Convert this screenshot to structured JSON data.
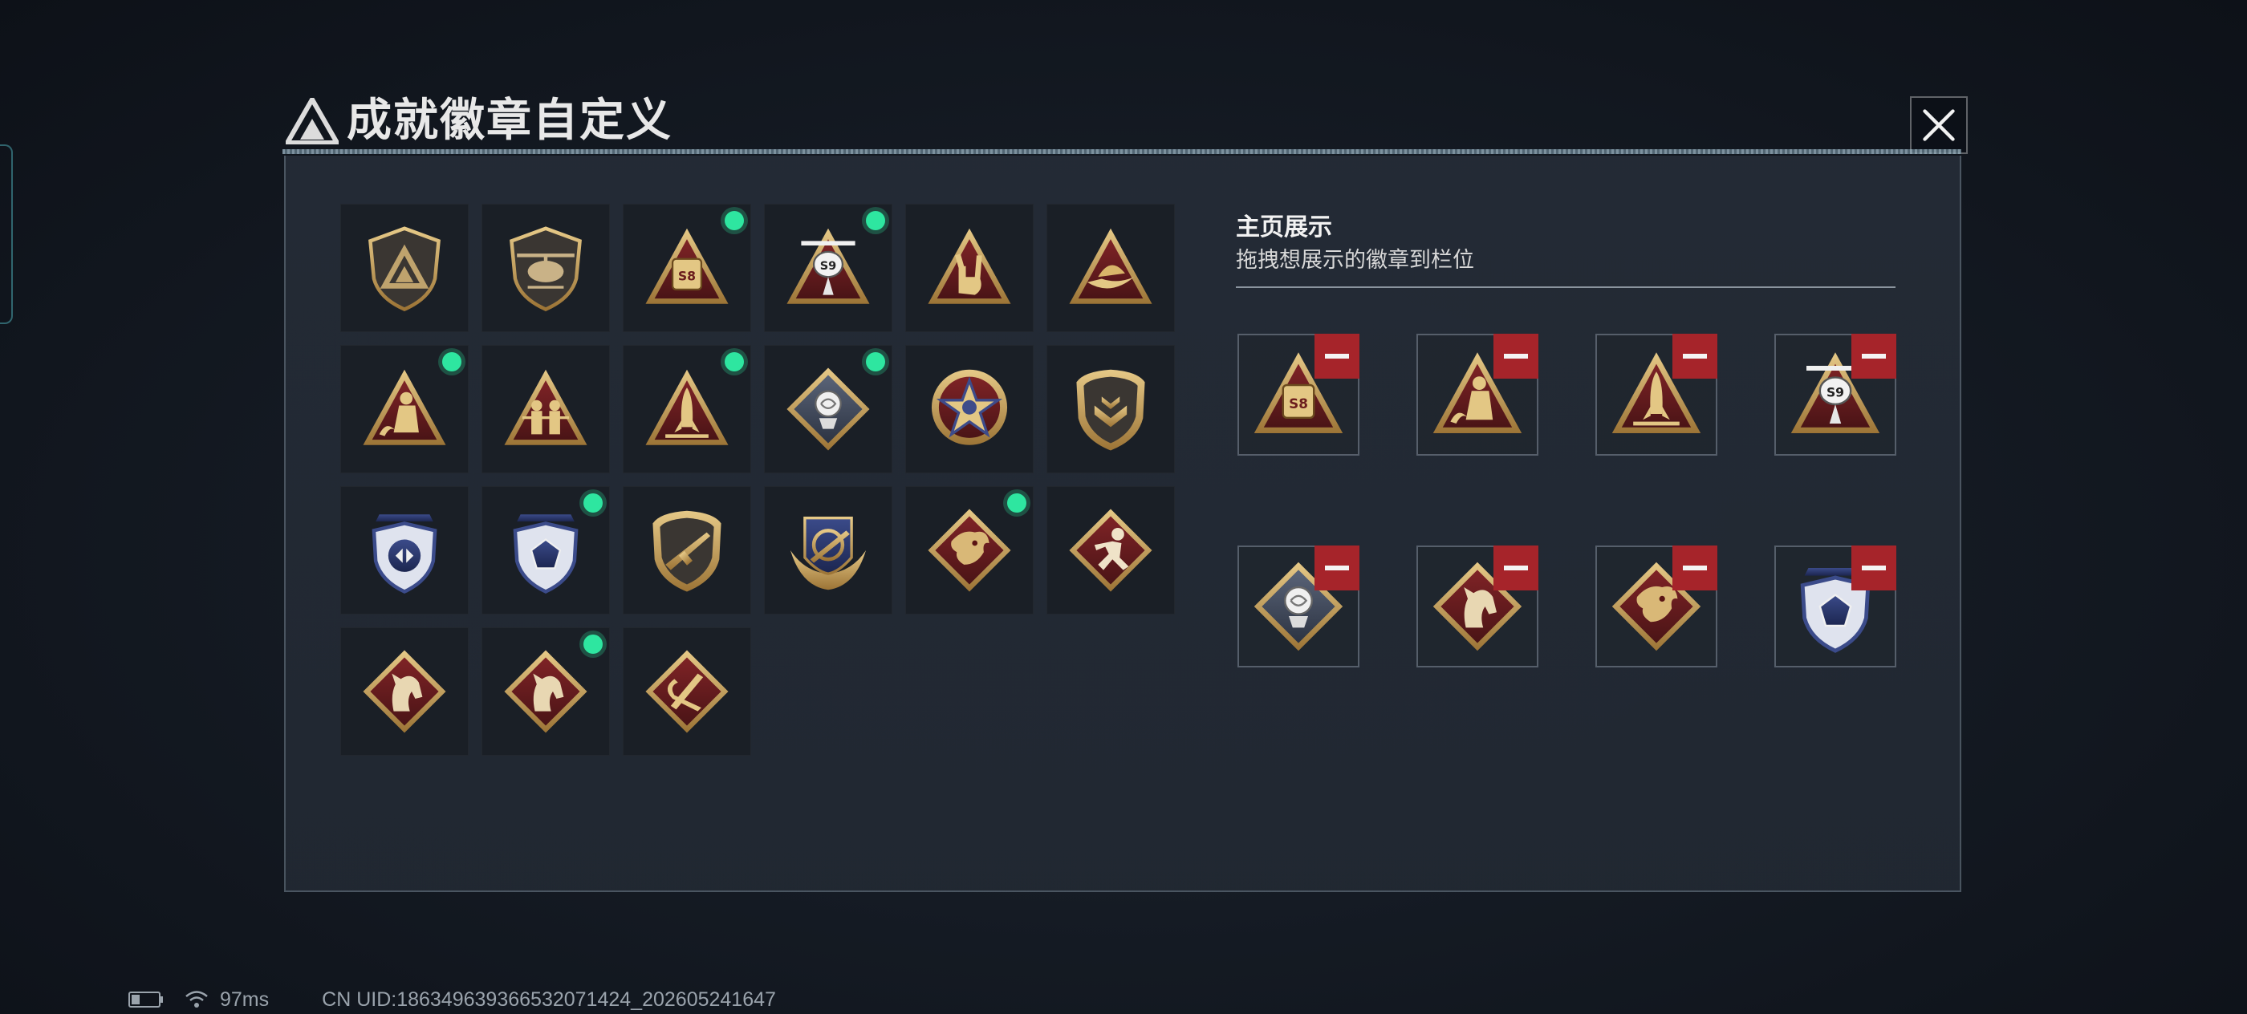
{
  "dialog": {
    "title": "成就徽章自定义"
  },
  "showcase": {
    "title": "主页展示",
    "hint": "拖拽想展示的徽章到栏位",
    "slots": [
      {
        "badge": "fuel-truck-s8-triangle-badge"
      },
      {
        "badge": "wave-figure-triangle-badge"
      },
      {
        "badge": "rocket-triangle-badge"
      },
      {
        "badge": "helicopter-s9-triangle-badge"
      },
      {
        "badge": "rose-diamond-badge"
      },
      {
        "badge": "horse-diamond-badge"
      },
      {
        "badge": "dragon-diamond-badge"
      },
      {
        "badge": "blue-gem-shield-badge"
      }
    ]
  },
  "badges": [
    {
      "icon": "triangle-logo-shield-badge",
      "selected": false
    },
    {
      "icon": "helicopter-shield-badge",
      "selected": false
    },
    {
      "icon": "fuel-truck-s8-triangle-badge",
      "selected": true
    },
    {
      "icon": "helicopter-s9-triangle-badge",
      "selected": true
    },
    {
      "icon": "rock-hand-triangle-badge",
      "selected": false
    },
    {
      "icon": "boat-triangle-badge",
      "selected": false
    },
    {
      "icon": "wave-figure-triangle-badge",
      "selected": true
    },
    {
      "icon": "soldiers-triangle-badge",
      "selected": false
    },
    {
      "icon": "rocket-triangle-badge",
      "selected": true
    },
    {
      "icon": "rose-diamond-badge",
      "selected": true
    },
    {
      "icon": "star-medal-badge",
      "selected": false
    },
    {
      "icon": "chevron-shield-badge",
      "selected": false
    },
    {
      "icon": "blue-arrows-shield-badge",
      "selected": false
    },
    {
      "icon": "blue-gem-shield-badge",
      "selected": true
    },
    {
      "icon": "rifle-shield-badge",
      "selected": false
    },
    {
      "icon": "wings-emblem-badge",
      "selected": false
    },
    {
      "icon": "dragon-diamond-badge",
      "selected": true
    },
    {
      "icon": "runner-diamond-badge",
      "selected": false
    },
    {
      "icon": "horse-diamond-badge",
      "selected": false
    },
    {
      "icon": "horse-diamond-badge",
      "selected": true
    },
    {
      "icon": "tools-diamond-badge",
      "selected": false
    }
  ],
  "status": {
    "latency": "97ms",
    "uid": "CN UID:18634963936653207142​4_202605241647"
  },
  "colors": {
    "selected_dot": "#2ee6a0",
    "remove_button": "#a6242a",
    "gold": "#c9a45c",
    "crimson": "#6e1e20",
    "navy": "#2b3a6e"
  }
}
